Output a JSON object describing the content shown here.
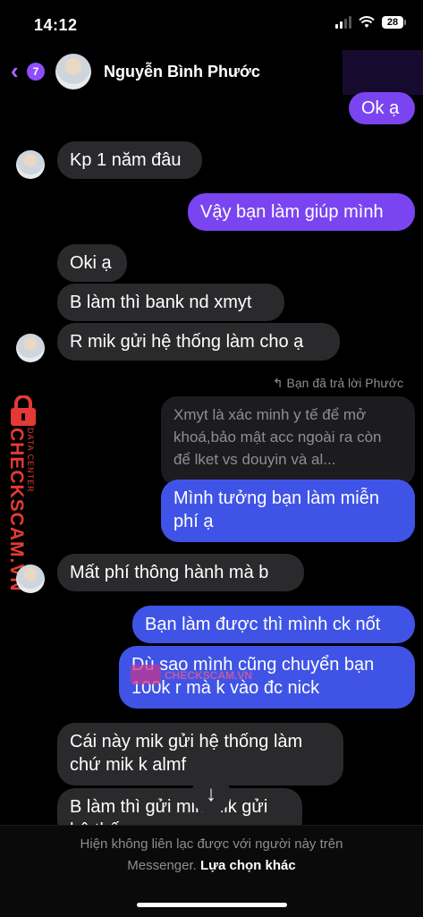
{
  "status": {
    "time": "14:12",
    "battery": "28"
  },
  "header": {
    "back_count": "7",
    "contact_name": "Nguyễn Bình Phước"
  },
  "messages": {
    "m1": "Ok ạ",
    "m2": "Kp 1 năm đâu",
    "m3": "Vậy bạn làm giúp mình",
    "m4": "Oki ạ",
    "m5": "B làm thì bank nd xmyt",
    "m6": "R mik gửi hệ thống làm cho ạ",
    "reply_label": "Bạn đã trả lời Phước",
    "quoted": "Xmyt là xác minh y tế để mở khoá,bảo mật acc ngoài ra còn để lket vs douyin và al...",
    "m7": "Mình tưởng bạn làm miễn phí ạ",
    "m8": "Mất phí thông hành mà b",
    "m9": "Bạn làm được thì mình ck nốt",
    "m10": "Dù sao mình cũng chuyển bạn 100k r mà k vào đc nick",
    "m11": "Cái này mik gửi hệ thống làm chứ mik k almf",
    "m12": "B làm thì gửi mik mik gửi hệ thố"
  },
  "watermark": {
    "brand": "CHECKSCAM.VN",
    "sub": "DATA CENTER",
    "center": "CHECKSCAM.VN"
  },
  "footer": {
    "line1": "Hiện không liên lạc được với người này trên",
    "line2_muted": "Messenger.",
    "line2_link": "Lựa chọn khác"
  },
  "colors": {
    "accent": "#8e4dff",
    "outgoing_purple": "#7a45f0",
    "outgoing_blue": "#3f54e6",
    "incoming": "#2a2a2c",
    "watermark": "#e53935"
  },
  "icons": {
    "back": "chevron-left-icon",
    "wifi": "wifi-icon",
    "signal": "cellular-signal-icon",
    "reply": "reply-arrow-icon",
    "scroll": "arrow-down-icon"
  }
}
